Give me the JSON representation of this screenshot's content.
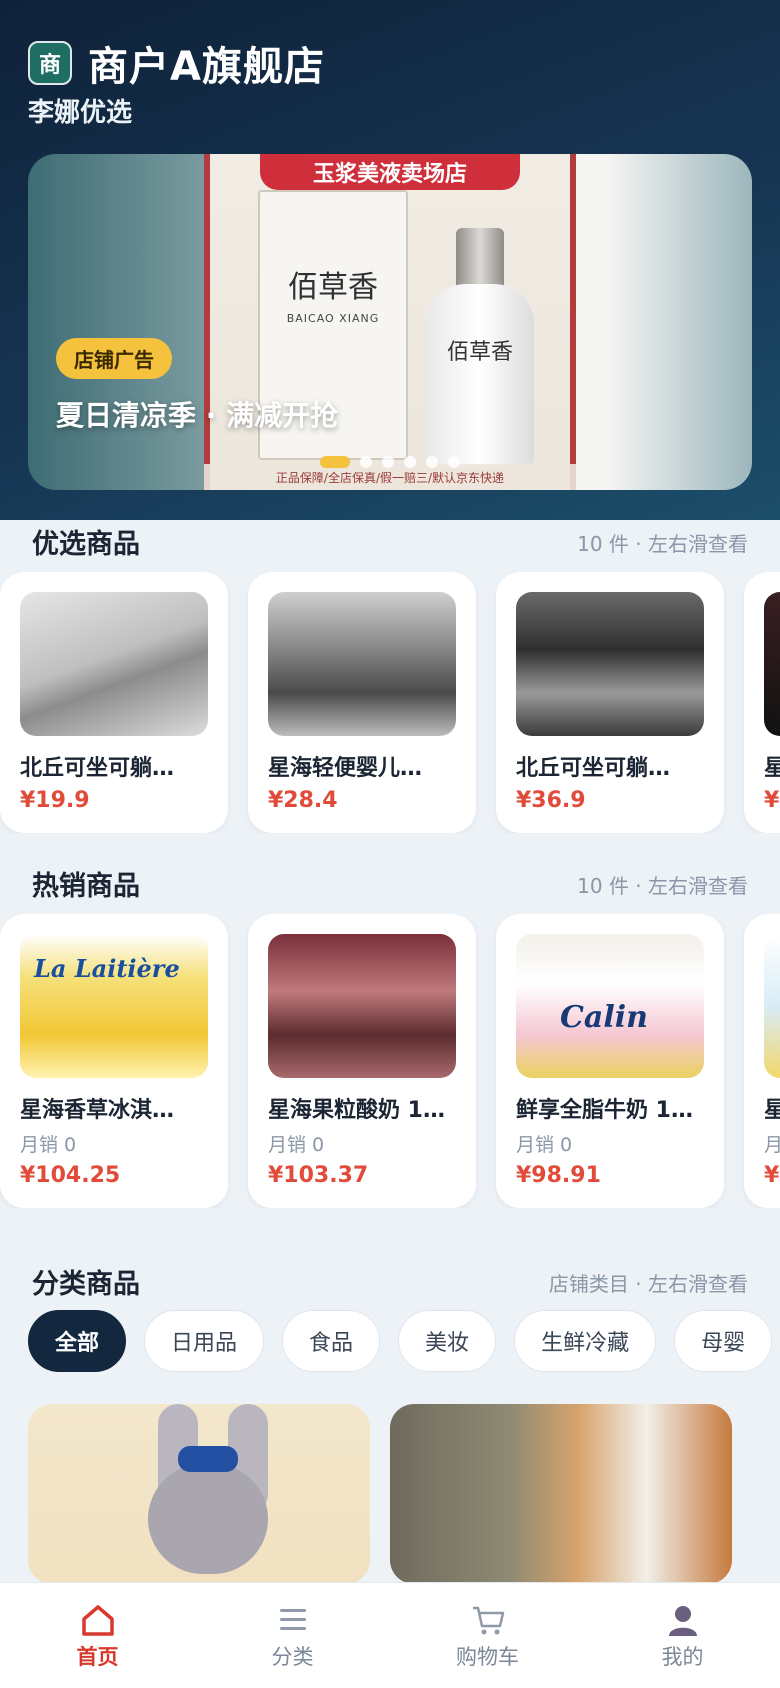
{
  "store": {
    "logo_char": "商",
    "name": "商户A旗舰店",
    "subtitle": "李娜优选"
  },
  "banner": {
    "store_tag": "玉浆美液卖场店",
    "product_brand": "佰草香",
    "product_brand_en": "BAICAO XIANG",
    "footer_text": "正品保障/全店保真/假一赔三/默认京东快递",
    "ad_badge": "店铺广告",
    "title": "夏日清凉季 · 满减开抢",
    "slide_count": 6,
    "active_slide": 1
  },
  "featured": {
    "title": "优选商品",
    "meta": "10 件 · 左右滑查看",
    "items": [
      {
        "name": "北丘可坐可躺…",
        "price": "¥19.9"
      },
      {
        "name": "星海轻便婴儿…",
        "price": "¥28.4"
      },
      {
        "name": "北丘可坐可躺…",
        "price": "¥36.9"
      },
      {
        "name": "星",
        "price": "¥"
      }
    ]
  },
  "hot": {
    "title": "热销商品",
    "meta": "10 件 · 左右滑查看",
    "items": [
      {
        "name": "星海香草冰淇…",
        "sold": "月销 0",
        "price": "¥104.25",
        "image_text": "La Laitière"
      },
      {
        "name": "星海果粒酸奶 1…",
        "sold": "月销 0",
        "price": "¥103.37",
        "image_text": ""
      },
      {
        "name": "鲜享全脂牛奶 1…",
        "sold": "月销 0",
        "price": "¥98.91",
        "image_text": "Calin"
      },
      {
        "name": "星",
        "sold": "月",
        "price": "¥",
        "image_text": ""
      }
    ]
  },
  "categories": {
    "title": "分类商品",
    "meta": "店铺类目 · 左右滑查看",
    "chips": [
      "全部",
      "日用品",
      "食品",
      "美妆",
      "生鲜冷藏",
      "母婴"
    ],
    "active": "全部"
  },
  "tabbar": {
    "items": [
      {
        "label": "首页",
        "icon": "home-icon",
        "active": true
      },
      {
        "label": "分类",
        "icon": "list-icon",
        "active": false
      },
      {
        "label": "购物车",
        "icon": "cart-icon",
        "active": false
      },
      {
        "label": "我的",
        "icon": "user-icon",
        "active": false
      }
    ],
    "active_color": "#d8392c",
    "inactive_color": "#7c8797"
  },
  "colors": {
    "price": "#e04b3a",
    "header_bg": "#163553",
    "badge": "#f4c23d",
    "chip_active": "#13273f"
  }
}
